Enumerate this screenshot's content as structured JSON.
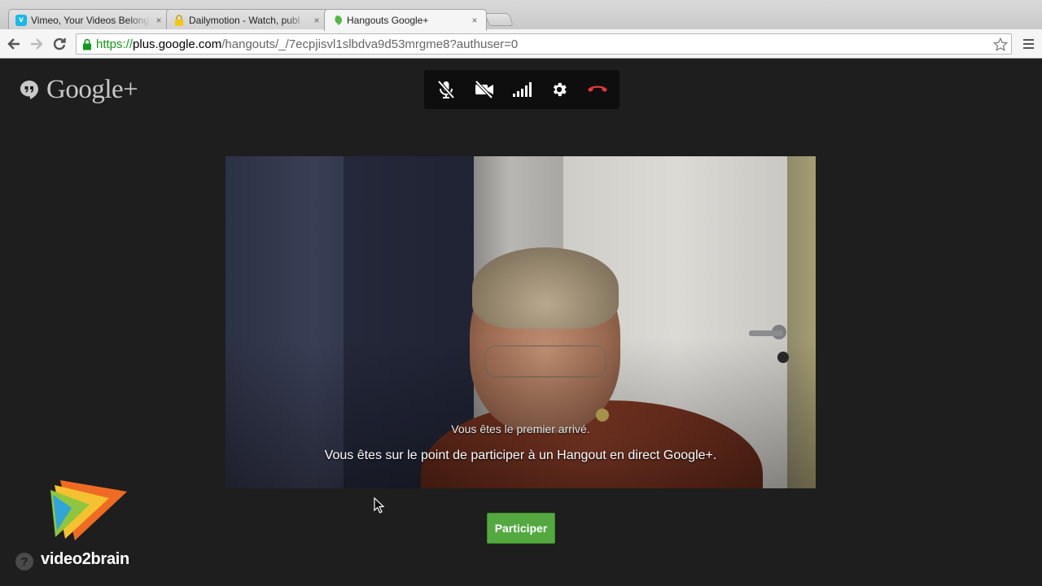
{
  "browser": {
    "tabs": [
      {
        "title": "Vimeo, Your Videos Belong",
        "close": "×",
        "favicon": "vimeo-icon",
        "color": "#1ab7ea",
        "favicon_glyph": "v"
      },
      {
        "title": "Dailymotion - Watch, publ",
        "close": "×",
        "favicon": "dailymotion-icon",
        "color": "#f5c518",
        "favicon_glyph": ""
      },
      {
        "title": "Hangouts Google+",
        "close": "×",
        "favicon": "hangouts-icon",
        "color": "#52b848",
        "favicon_glyph": ""
      }
    ],
    "url": {
      "scheme": "https://",
      "host": "plus.google.com",
      "path": "/hangouts/_/7ecpjisvl1slbdva9d53mrgme8?authuser=0"
    }
  },
  "page": {
    "logo_text": "Google+",
    "controls": [
      {
        "name": "mute-mic-icon"
      },
      {
        "name": "camera-off-icon"
      },
      {
        "name": "bandwidth-icon"
      },
      {
        "name": "settings-icon"
      },
      {
        "name": "hang-up-icon",
        "color": "#e53935"
      }
    ],
    "message_first": "Vous êtes le premier arrivé.",
    "message_main": "Vous êtes sur le point de participer à un Hangout en direct Google+.",
    "join_button": "Participer",
    "join_color": "#53a93f"
  },
  "watermark": {
    "brand": "video2brain",
    "help": "?"
  }
}
